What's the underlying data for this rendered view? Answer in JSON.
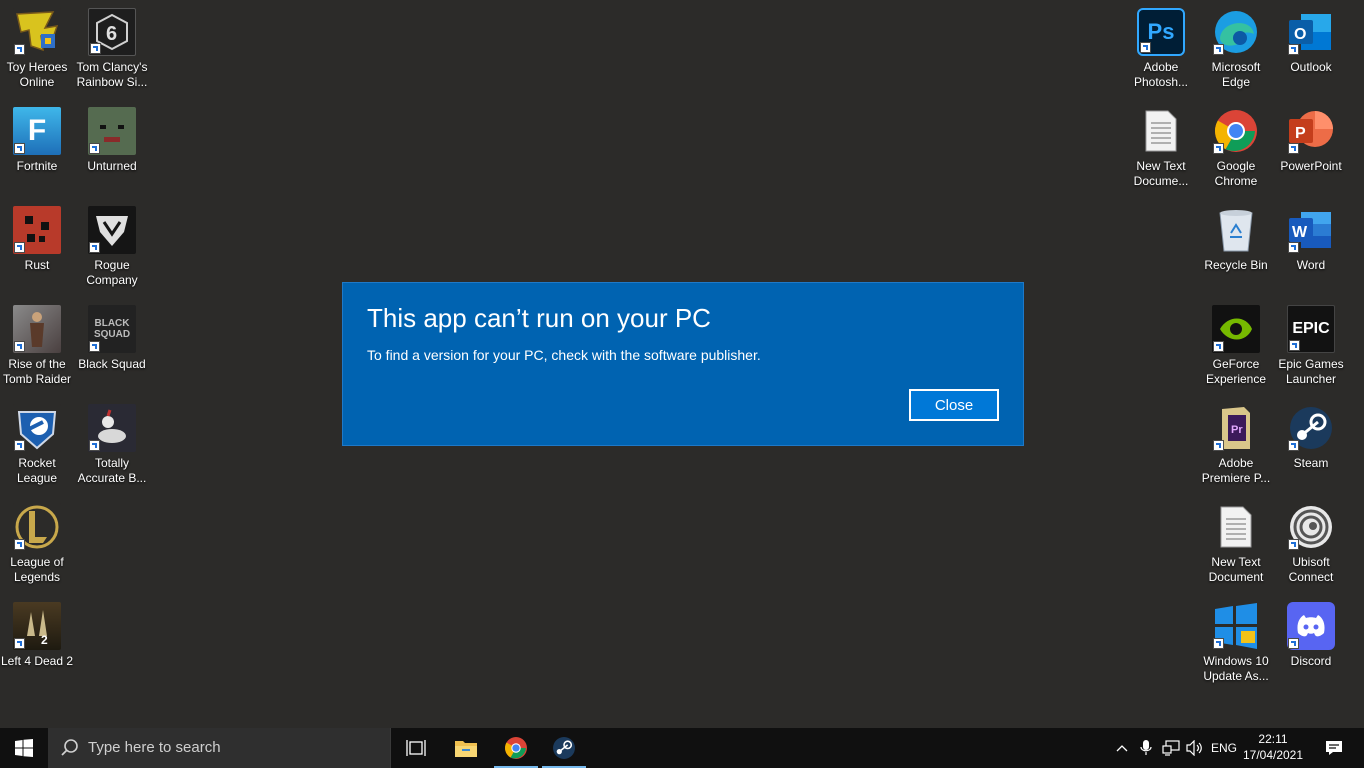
{
  "desktop_icons": [
    {
      "key": "toy-heroes-online",
      "label": "Toy Heroes Online",
      "text": "",
      "bg": "#d4c21a"
    },
    {
      "key": "rainbow-six",
      "label": "Tom Clancy's Rainbow Si...",
      "text": "6",
      "bg": "#2a2a2a"
    },
    {
      "key": "fortnite",
      "label": "Fortnite",
      "text": "F",
      "bg": "#2aa1d8"
    },
    {
      "key": "unturned",
      "label": "Unturned",
      "text": "",
      "bg": "#4b6b4b"
    },
    {
      "key": "rust",
      "label": "Rust",
      "text": "",
      "bg": "#c0392b"
    },
    {
      "key": "rogue-company",
      "label": "Rogue Company",
      "text": "",
      "bg": "#1c1c1c"
    },
    {
      "key": "rise-tomb-raider",
      "label": "Rise of the Tomb Raider",
      "text": "",
      "bg": "#6e6e6e"
    },
    {
      "key": "black-squad",
      "label": "Black Squad",
      "text": "BLACK SQUAD",
      "bg": "#222222"
    },
    {
      "key": "rocket-league",
      "label": "Rocket League",
      "text": "",
      "bg": "#2c5fa8"
    },
    {
      "key": "totally-accurate",
      "label": "Totally Accurate B...",
      "text": "",
      "bg": "#3a3a4a"
    },
    {
      "key": "league-of-legends",
      "label": "League of Legends",
      "text": "L",
      "bg": "#1a1a1a"
    },
    {
      "key": "left-4-dead-2",
      "label": "Left 4 Dead 2",
      "text": "4",
      "bg": "#3a3020"
    },
    {
      "key": "photoshop",
      "label": "Adobe Photosh...",
      "text": "Ps",
      "bg": "#001e36"
    },
    {
      "key": "edge",
      "label": "Microsoft Edge",
      "text": "",
      "bg": "#2b2a28"
    },
    {
      "key": "outlook",
      "label": "Outlook",
      "text": "O",
      "bg": "#0a64ad"
    },
    {
      "key": "new-text-doc-1",
      "label": "New Text Docume...",
      "text": "",
      "bg": "#e9e9e9"
    },
    {
      "key": "chrome",
      "label": "Google Chrome",
      "text": "",
      "bg": "#2b2a28"
    },
    {
      "key": "powerpoint",
      "label": "PowerPoint",
      "text": "P",
      "bg": "#c43e1c"
    },
    {
      "key": "recycle-bin",
      "label": "Recycle Bin",
      "text": "",
      "bg": "#2b2a28"
    },
    {
      "key": "word",
      "label": "Word",
      "text": "W",
      "bg": "#185abd"
    },
    {
      "key": "geforce",
      "label": "GeForce Experience",
      "text": "",
      "bg": "#111111"
    },
    {
      "key": "epic-games",
      "label": "Epic Games Launcher",
      "text": "EPIC",
      "bg": "#121212"
    },
    {
      "key": "premiere",
      "label": "Adobe Premiere P...",
      "text": "Pr",
      "bg": "#2d1a3a"
    },
    {
      "key": "steam",
      "label": "Steam",
      "text": "",
      "bg": "#1b2838"
    },
    {
      "key": "new-text-doc-2",
      "label": "New Text Document",
      "text": "",
      "bg": "#e9e9e9"
    },
    {
      "key": "ubisoft",
      "label": "Ubisoft Connect",
      "text": "",
      "bg": "#2b2a28"
    },
    {
      "key": "win10-update",
      "label": "Windows 10 Update As...",
      "text": "",
      "bg": "#2b2a28"
    },
    {
      "key": "discord",
      "label": "Discord",
      "text": "",
      "bg": "#5865f2"
    }
  ],
  "dialog": {
    "title": "This app can’t run on your PC",
    "message": "To find a version for your PC, check with the software publisher.",
    "close_label": "Close",
    "background": "#0063b1"
  },
  "taskbar": {
    "search_placeholder": "Type here to search",
    "language": "ENG",
    "time": "22:11",
    "date": "17/04/2021",
    "apps": [
      {
        "key": "task-view",
        "icon": "task-view-icon"
      },
      {
        "key": "file-explorer",
        "icon": "folder-icon"
      },
      {
        "key": "chrome",
        "icon": "chrome-icon"
      },
      {
        "key": "steam",
        "icon": "steam-icon"
      }
    ]
  },
  "colors": {
    "desktop_bg": "#2c2b29",
    "taskbar_bg": "#101010",
    "accent": "#0078d7",
    "active_indicator": "#76b9ed"
  }
}
